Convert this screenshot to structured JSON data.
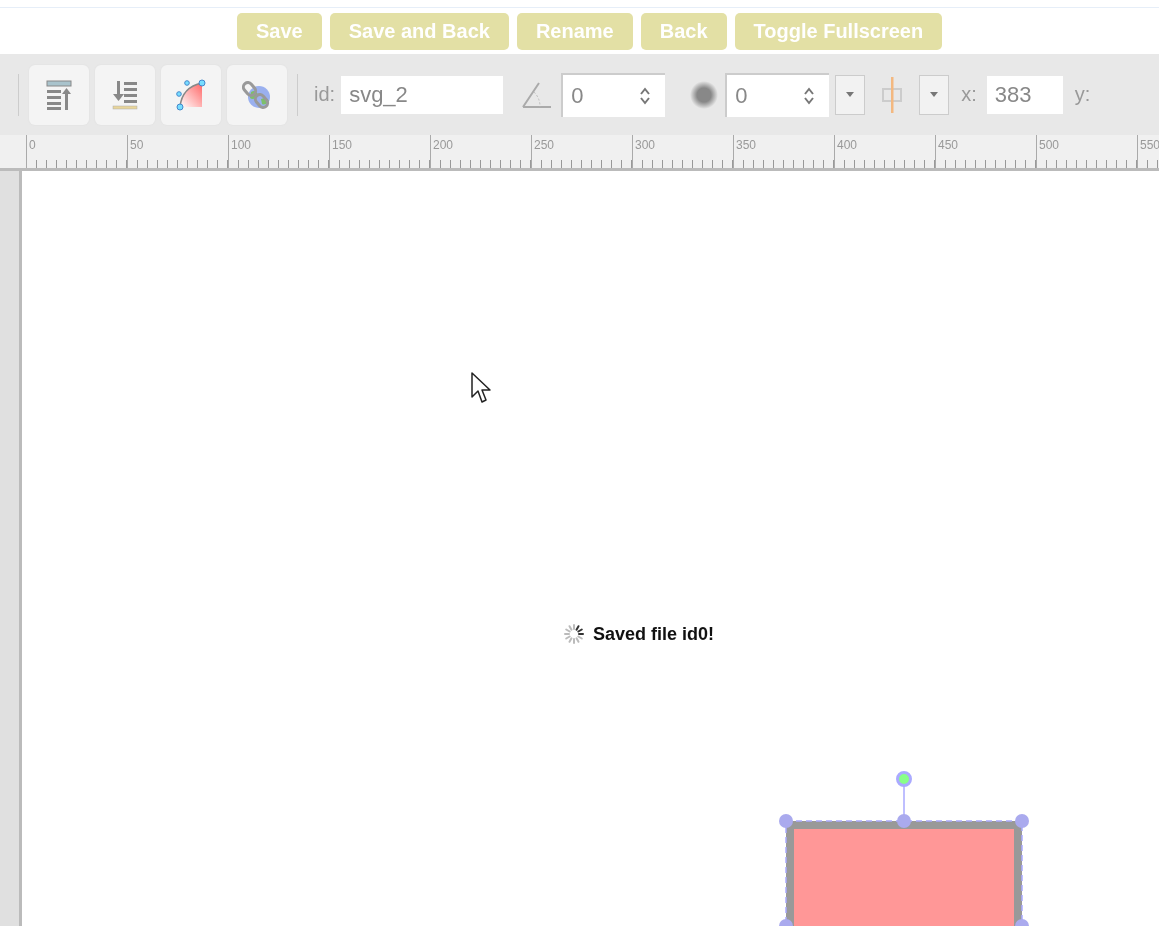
{
  "top_buttons": [
    "Save",
    "Save and Back",
    "Rename",
    "Back",
    "Toggle Fullscreen"
  ],
  "toolbar": {
    "id_label": "id:",
    "id_value": "svg_2",
    "angle_value": "0",
    "blur_value": "0",
    "x_label": "x:",
    "x_value": "383",
    "y_label": "y:"
  },
  "ruler": {
    "labels": [
      "0",
      "50",
      "100",
      "150",
      "200",
      "250",
      "300",
      "350",
      "400",
      "450",
      "500",
      "550"
    ]
  },
  "status": {
    "message": "Saved file id0!"
  }
}
